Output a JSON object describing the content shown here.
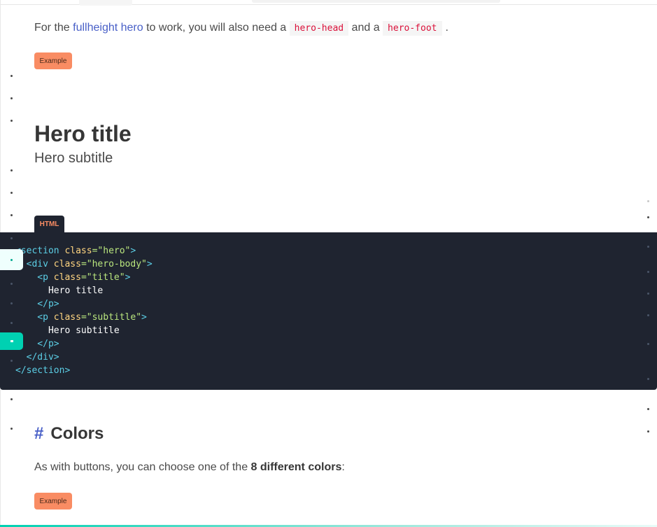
{
  "intro": {
    "text_before": "For the ",
    "link": "fullheight hero",
    "text_mid1": " to work, you will also need a ",
    "code1": "hero-head",
    "text_mid2": " and a ",
    "code2": "hero-foot",
    "text_after": "."
  },
  "example_label": "Example",
  "hero": {
    "title": "Hero title",
    "subtitle": "Hero subtitle"
  },
  "code_tab": "HTML",
  "code": {
    "l1a": "<section",
    "l1b": " class",
    "l1c": "=\"hero\"",
    "l1d": ">",
    "l2a": "  <div",
    "l2b": " class",
    "l2c": "=\"hero-body\"",
    "l2d": ">",
    "l3a": "    <p",
    "l3b": " class",
    "l3c": "=\"title\"",
    "l3d": ">",
    "l4": "      Hero title",
    "l5": "    </p>",
    "l6a": "    <p",
    "l6b": " class",
    "l6c": "=\"subtitle\"",
    "l6d": ">",
    "l7": "      Hero subtitle",
    "l8": "    </p>",
    "l9": "  </div>",
    "l10": "</section>"
  },
  "colors_section": {
    "hash": "#",
    "heading": "Colors",
    "text_before": "As with buttons, you can choose one of the ",
    "text_bold": "8 different colors",
    "text_after": ":"
  },
  "theme": {
    "link": "#485fc7",
    "code_red": "#da1039",
    "accent_orange": "#f98c63",
    "teal": "#00d1b2",
    "code_bg": "#1f2430"
  }
}
